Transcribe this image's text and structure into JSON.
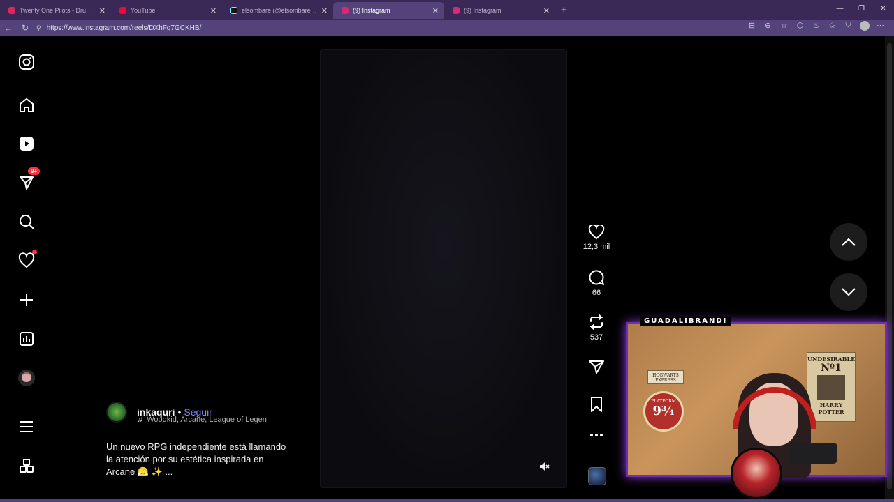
{
  "browser": {
    "tabs": [
      {
        "title": "Twenty One Pilots - Drum Show (f",
        "favicon_color": "#e0245e",
        "active": false
      },
      {
        "title": "YouTube",
        "favicon_color": "#ff0033",
        "active": false
      },
      {
        "title": "elsombare (@elsombare) | TikTok",
        "favicon_color": "#111111",
        "active": false
      },
      {
        "title": "(9) Instagram",
        "favicon_color": "#d62976",
        "active": true
      },
      {
        "title": "(9) Instagram",
        "favicon_color": "#d62976",
        "active": false
      }
    ],
    "url": "https://www.instagram.com/reels/DXhFg7GCKHB/"
  },
  "sidebar": {
    "icons": [
      "instagram-logo-icon",
      "home-icon",
      "reels-icon",
      "messages-icon",
      "search-icon",
      "notifications-icon",
      "create-icon",
      "dashboard-icon",
      "profile-icon",
      "more-icon",
      "also-from-meta-icon"
    ],
    "messages_badge": "9+"
  },
  "reel": {
    "username": "inkaquri",
    "separator": "•",
    "follow_label": "Seguir",
    "audio": "Woodkid, Arcane, League of Legen",
    "description_lines": [
      "Un nuevo RPG independiente está llamando",
      "la atención por su estética inspirada en",
      "Arcane 😤 ✨ ..."
    ],
    "likes": "12,3 mil",
    "comments": "66",
    "reposts": "537"
  },
  "webcam": {
    "label": "GUADALIBRANDI",
    "poster_title": "UNDESIRABLE",
    "poster_no": "Nº1",
    "poster_name": "HARRY POTTER",
    "hogwarts": "HOGWARTS EXPRESS",
    "platform": "PLATFORM",
    "platform_num": "9¾"
  },
  "colors": {
    "browser_chrome": "#3a2957",
    "accent_link": "#7b8cff",
    "badge": "#ff3040",
    "webcam_border": "#6c2fb0"
  }
}
